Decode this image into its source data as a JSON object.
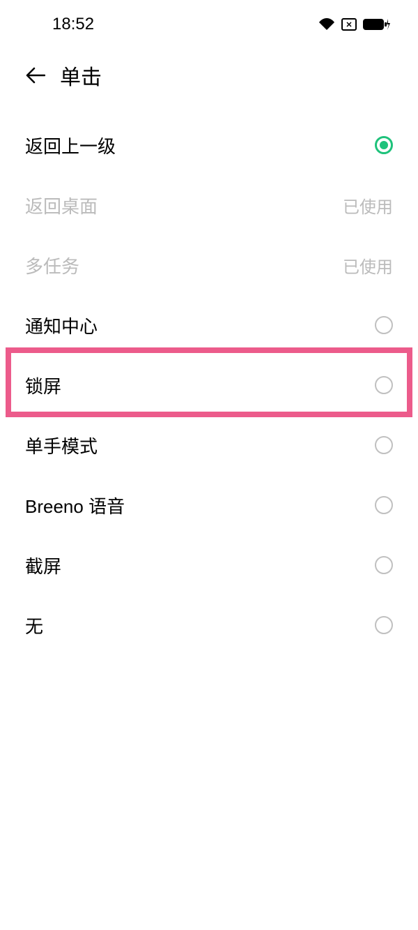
{
  "statusBar": {
    "time": "18:52"
  },
  "header": {
    "title": "单击"
  },
  "options": [
    {
      "label": "返回上一级",
      "type": "radio",
      "selected": true,
      "disabled": false
    },
    {
      "label": "返回桌面",
      "type": "status",
      "status": "已使用",
      "disabled": true
    },
    {
      "label": "多任务",
      "type": "status",
      "status": "已使用",
      "disabled": true
    },
    {
      "label": "通知中心",
      "type": "radio",
      "selected": false,
      "disabled": false
    },
    {
      "label": "锁屏",
      "type": "radio",
      "selected": false,
      "disabled": false,
      "highlighted": true
    },
    {
      "label": "单手模式",
      "type": "radio",
      "selected": false,
      "disabled": false
    },
    {
      "label": "Breeno 语音",
      "type": "radio",
      "selected": false,
      "disabled": false
    },
    {
      "label": "截屏",
      "type": "radio",
      "selected": false,
      "disabled": false
    },
    {
      "label": "无",
      "type": "radio",
      "selected": false,
      "disabled": false
    }
  ]
}
